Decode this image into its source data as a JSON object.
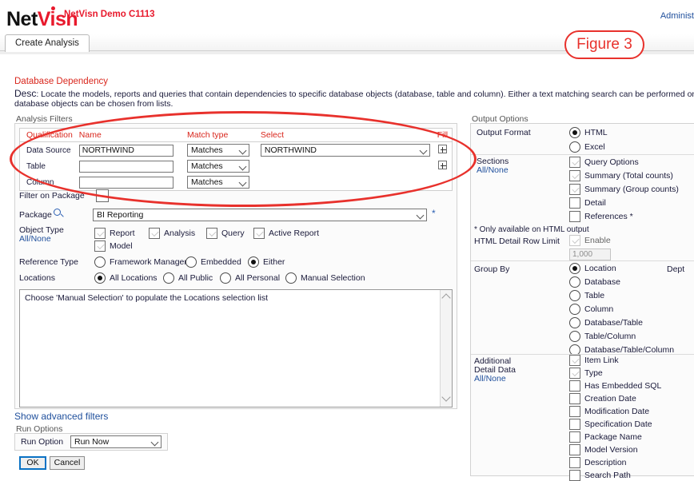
{
  "header": {
    "logo_net": "Net",
    "logo_visn": "Visn",
    "demo_title": "NetVisn Demo C1113",
    "admin_link": "Administ"
  },
  "tab": {
    "label": "Create Analysis"
  },
  "description": {
    "title": "Database Dependency",
    "desc_label": "Desc",
    "line1": ": Locate the models, reports and queries that contain dependencies to specific database objects (database, table and column). Either a text matching search can be performed on any database qua",
    "line2": "database objects can be chosen from lists."
  },
  "annotation": {
    "figure_label": "Figure 3"
  },
  "filters": {
    "panel_label": "Analysis Filters",
    "columns": [
      "Qualification",
      "Name",
      "Match type",
      "Select",
      "Fill"
    ],
    "rows": [
      {
        "qualification": "Data Source",
        "name": "NORTHWIND",
        "match_type": "Matches",
        "select": "NORTHWIND",
        "has_select": true,
        "has_fill": true
      },
      {
        "qualification": "Table",
        "name": "",
        "match_type": "Matches",
        "select": "",
        "has_select": false,
        "has_fill": true
      },
      {
        "qualification": "Column",
        "name": "",
        "match_type": "Matches",
        "select": "",
        "has_select": false,
        "has_fill": false
      }
    ],
    "filter_on_package_label": "Filter on Package",
    "filter_on_package_checked": false,
    "package_label": "Package",
    "package_value": "BI Reporting",
    "package_required_mark": "*",
    "object_type_label": "Object Type",
    "object_type_allnone": "All/None",
    "object_types": [
      {
        "label": "Report",
        "checked": true
      },
      {
        "label": "Analysis",
        "checked": true
      },
      {
        "label": "Query",
        "checked": true
      },
      {
        "label": "Active Report",
        "checked": true
      },
      {
        "label": "Model",
        "checked": true
      }
    ],
    "reference_type_label": "Reference Type",
    "reference_types": [
      {
        "label": "Framework Manager",
        "selected": false
      },
      {
        "label": "Embedded",
        "selected": false
      },
      {
        "label": "Either",
        "selected": true
      }
    ],
    "locations_label": "Locations",
    "locations_options": [
      {
        "label": "All Locations",
        "selected": true
      },
      {
        "label": "All Public",
        "selected": false
      },
      {
        "label": "All Personal",
        "selected": false
      },
      {
        "label": "Manual Selection",
        "selected": false
      }
    ],
    "locations_textarea": "Choose 'Manual Selection' to populate the Locations selection list"
  },
  "advanced_link": "Show advanced filters",
  "run_options": {
    "panel_label": "Run Options",
    "field_label": "Run Option",
    "value": "Run Now"
  },
  "buttons": {
    "ok": "OK",
    "cancel": "Cancel"
  },
  "output": {
    "panel_label": "Output Options",
    "format_label": "Output Format",
    "formats": [
      {
        "label": "HTML",
        "selected": true
      },
      {
        "label": "Excel",
        "selected": false
      }
    ],
    "sections_label": "Sections",
    "sections_allnone": "All/None",
    "sections": [
      {
        "label": "Query Options",
        "checked": true
      },
      {
        "label": "Summary (Total counts)",
        "checked": true
      },
      {
        "label": "Summary (Group counts)",
        "checked": true
      },
      {
        "label": "Detail",
        "checked": false
      },
      {
        "label": "References *",
        "checked": false
      }
    ],
    "footnote": "* Only available on HTML output",
    "row_limit_label": "HTML Detail Row Limit",
    "row_limit_enable_label": "Enable",
    "row_limit_enabled": true,
    "row_limit_value": "1,000",
    "group_by_label": "Group By",
    "group_by_extra": "Dept",
    "group_by": [
      {
        "label": "Location",
        "selected": true
      },
      {
        "label": "Database",
        "selected": false
      },
      {
        "label": "Table",
        "selected": false
      },
      {
        "label": "Column",
        "selected": false
      },
      {
        "label": "Database/Table",
        "selected": false
      },
      {
        "label": "Table/Column",
        "selected": false
      },
      {
        "label": "Database/Table/Column",
        "selected": false
      }
    ],
    "detail_label_l1": "Additional",
    "detail_label_l2": "Detail Data",
    "detail_allnone": "All/None",
    "detail_data": [
      {
        "label": "Item Link",
        "checked": true
      },
      {
        "label": "Type",
        "checked": true
      },
      {
        "label": "Has Embedded SQL",
        "checked": false
      },
      {
        "label": "Creation Date",
        "checked": false
      },
      {
        "label": "Modification Date",
        "checked": false
      },
      {
        "label": "Specification Date",
        "checked": false
      },
      {
        "label": "Package Name",
        "checked": false
      },
      {
        "label": "Model Version",
        "checked": false
      },
      {
        "label": "Description",
        "checked": false
      },
      {
        "label": "Search Path",
        "checked": false
      }
    ]
  }
}
